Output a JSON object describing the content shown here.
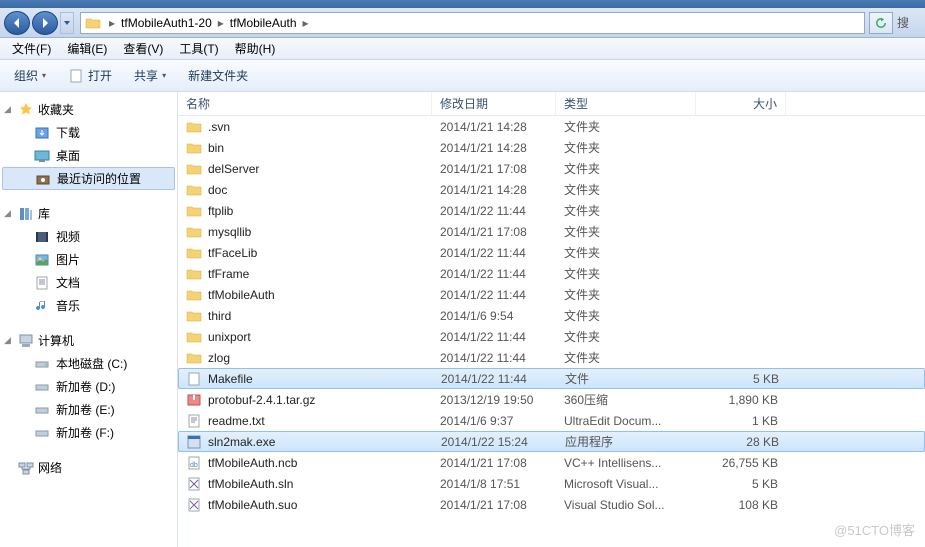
{
  "breadcrumb": {
    "seg1": "tfMobileAuth1-20",
    "seg2": "tfMobileAuth"
  },
  "menubar": {
    "file": "文件(F)",
    "edit": "编辑(E)",
    "view": "查看(V)",
    "tools": "工具(T)",
    "help": "帮助(H)"
  },
  "toolbar": {
    "organize": "组织",
    "open": "打开",
    "share": "共享",
    "newfolder": "新建文件夹"
  },
  "sidebar": {
    "fav_header": "收藏夹",
    "fav_items": [
      "下载",
      "桌面",
      "最近访问的位置"
    ],
    "lib_header": "库",
    "lib_items": [
      "视频",
      "图片",
      "文档",
      "音乐"
    ],
    "comp_header": "计算机",
    "comp_items": [
      "本地磁盘 (C:)",
      "新加卷 (D:)",
      "新加卷 (E:)",
      "新加卷 (F:)"
    ],
    "net_header": "网络"
  },
  "columns": {
    "name": "名称",
    "date": "修改日期",
    "type": "类型",
    "size": "大小"
  },
  "files": [
    {
      "name": ".svn",
      "date": "2014/1/21 14:28",
      "type": "文件夹",
      "size": "",
      "icon": "folder",
      "sel": false
    },
    {
      "name": "bin",
      "date": "2014/1/21 14:28",
      "type": "文件夹",
      "size": "",
      "icon": "folder",
      "sel": false
    },
    {
      "name": "delServer",
      "date": "2014/1/21 17:08",
      "type": "文件夹",
      "size": "",
      "icon": "folder",
      "sel": false
    },
    {
      "name": "doc",
      "date": "2014/1/21 14:28",
      "type": "文件夹",
      "size": "",
      "icon": "folder",
      "sel": false
    },
    {
      "name": "ftplib",
      "date": "2014/1/22 11:44",
      "type": "文件夹",
      "size": "",
      "icon": "folder",
      "sel": false
    },
    {
      "name": "mysqllib",
      "date": "2014/1/21 17:08",
      "type": "文件夹",
      "size": "",
      "icon": "folder",
      "sel": false
    },
    {
      "name": "tfFaceLib",
      "date": "2014/1/22 11:44",
      "type": "文件夹",
      "size": "",
      "icon": "folder",
      "sel": false
    },
    {
      "name": "tfFrame",
      "date": "2014/1/22 11:44",
      "type": "文件夹",
      "size": "",
      "icon": "folder",
      "sel": false
    },
    {
      "name": "tfMobileAuth",
      "date": "2014/1/22 11:44",
      "type": "文件夹",
      "size": "",
      "icon": "folder",
      "sel": false
    },
    {
      "name": "third",
      "date": "2014/1/6 9:54",
      "type": "文件夹",
      "size": "",
      "icon": "folder",
      "sel": false
    },
    {
      "name": "unixport",
      "date": "2014/1/22 11:44",
      "type": "文件夹",
      "size": "",
      "icon": "folder",
      "sel": false
    },
    {
      "name": "zlog",
      "date": "2014/1/22 11:44",
      "type": "文件夹",
      "size": "",
      "icon": "folder",
      "sel": false
    },
    {
      "name": "Makefile",
      "date": "2014/1/22 11:44",
      "type": "文件",
      "size": "5 KB",
      "icon": "file",
      "sel": true
    },
    {
      "name": "protobuf-2.4.1.tar.gz",
      "date": "2013/12/19 19:50",
      "type": "360压缩",
      "size": "1,890 KB",
      "icon": "archive",
      "sel": false
    },
    {
      "name": "readme.txt",
      "date": "2014/1/6 9:37",
      "type": "UltraEdit Docum...",
      "size": "1 KB",
      "icon": "text",
      "sel": false
    },
    {
      "name": "sln2mak.exe",
      "date": "2014/1/22 15:24",
      "type": "应用程序",
      "size": "28 KB",
      "icon": "exe",
      "sel": true
    },
    {
      "name": "tfMobileAuth.ncb",
      "date": "2014/1/21 17:08",
      "type": "VC++ Intellisens...",
      "size": "26,755 KB",
      "icon": "vc",
      "sel": false
    },
    {
      "name": "tfMobileAuth.sln",
      "date": "2014/1/8 17:51",
      "type": "Microsoft Visual...",
      "size": "5 KB",
      "icon": "sln",
      "sel": false
    },
    {
      "name": "tfMobileAuth.suo",
      "date": "2014/1/21 17:08",
      "type": "Visual Studio Sol...",
      "size": "108 KB",
      "icon": "sln",
      "sel": false
    }
  ],
  "watermark": "@51CTO博客",
  "search_hint": "搜"
}
